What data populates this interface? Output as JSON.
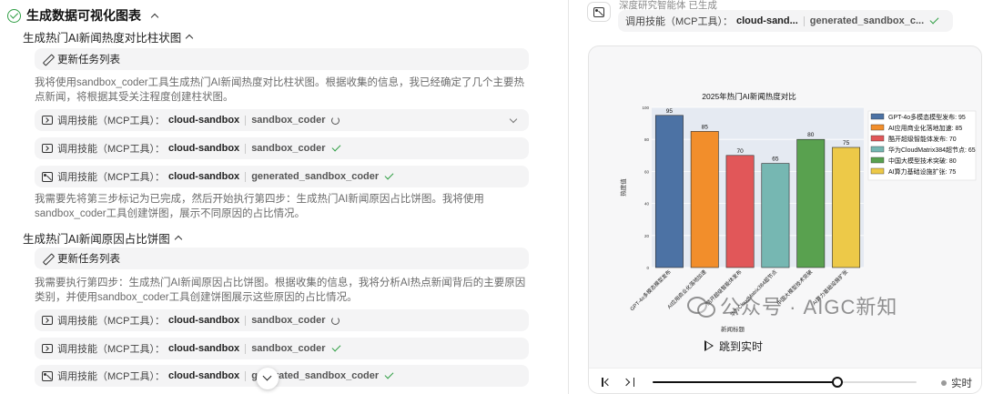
{
  "left": {
    "section_title": "生成数据可视化图表",
    "sub1_title": "生成热门AI新闻热度对比柱状图",
    "sub2_title": "生成热门AI新闻原因占比饼图",
    "update_task_label": "更新任务列表",
    "para1": "我将使用sandbox_coder工具生成热门AI新闻热度对比柱状图。根据收集的信息，我已经确定了几个主要热点新闻，将根据其受关注程度创建柱状图。",
    "para2": "我需要先将第三步标记为已完成，然后开始执行第四步：生成热门AI新闻原因占比饼图。我将使用sandbox_coder工具创建饼图，展示不同原因的占比情况。",
    "para3": "我需要执行第四步：生成热门AI新闻原因占比饼图。根据收集的信息，我将分析AI热点新闻背后的主要原因类别，并使用sandbox_coder工具创建饼图展示这些原因的占比情况。",
    "tool_label": "调用技能（MCP工具）：",
    "tool_server": "cloud-sandbox",
    "tools": [
      {
        "name": "sandbox_coder",
        "status": "loading"
      },
      {
        "name": "sandbox_coder",
        "status": "done"
      },
      {
        "name": "generated_sandbox_coder",
        "status": "done"
      },
      {
        "name": "sandbox_coder",
        "status": "loading"
      },
      {
        "name": "sandbox_coder",
        "status": "done"
      },
      {
        "name": "generated_sandbox_coder",
        "status": "done"
      }
    ]
  },
  "right": {
    "agent_status": "深度研究智能体 已生成",
    "tool_label": "调用技能（MCP工具）：",
    "tool_server": "cloud-sand...",
    "tool_name": "generated_sandbox_c...",
    "replay_label": "跳到实时",
    "live_label": "实时",
    "progress": 0.7
  },
  "watermark": {
    "text": "公众号 · AIGC新知"
  },
  "chart_data": {
    "type": "bar",
    "title": "2025年热门AI新闻热度对比",
    "xlabel": "新闻标题",
    "ylabel": "热度值",
    "ylim": [
      0,
      100
    ],
    "yticks": [
      0,
      20,
      40,
      60,
      80,
      100
    ],
    "categories": [
      "GPT-4o多模态模型发布",
      "AI应用商业化落地加速",
      "酷开超级智能体发布",
      "华为CloudMatrix384超节点",
      "中国大模型技术突破",
      "AI算力基础设施扩张"
    ],
    "values": [
      95,
      85,
      70,
      65,
      80,
      75
    ],
    "colors": [
      "#4c72a4",
      "#f28e2b",
      "#e15759",
      "#76b7b2",
      "#59a14f",
      "#edc948"
    ],
    "legend": [
      "GPT-4o多模态模型发布: 95",
      "AI应用商业化落地加速: 85",
      "酷开超级智能体发布: 70",
      "华为CloudMatrix384超节点: 65",
      "中国大模型技术突破: 80",
      "AI算力基础设施扩张: 75"
    ],
    "legend_position": "right",
    "grid": true
  }
}
